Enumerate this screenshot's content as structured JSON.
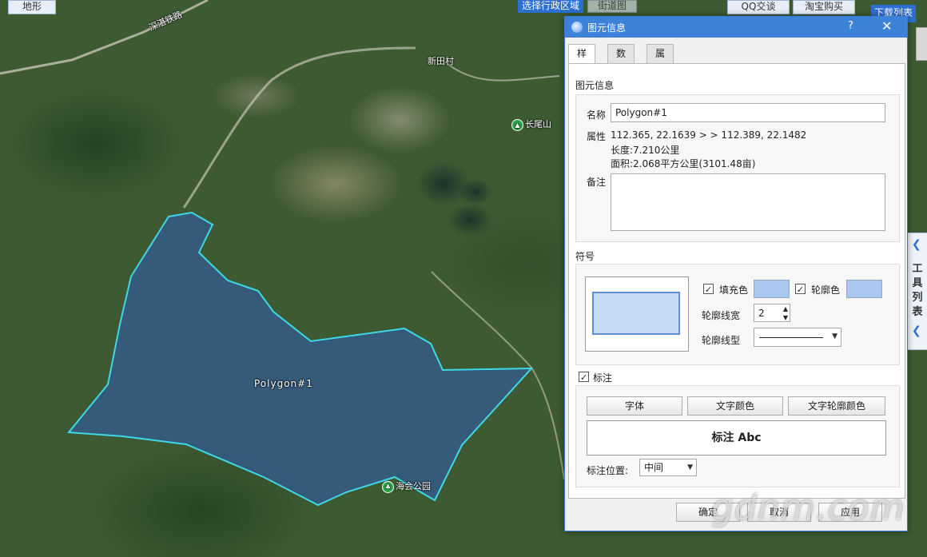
{
  "map": {
    "terrain_button": "地形",
    "region_button": "选择行政区域",
    "top_button_partial": "街道图",
    "qq_button": "QQ交谈",
    "taobao_button": "淘宝购买",
    "download_list": "下载列表",
    "rail_label": "深湛铁路",
    "village_label": "新田村",
    "mountain_label": "长尾山",
    "park_label": "海会公园",
    "polygon_label": "Polygon#1",
    "tool_sidebar": "工具列表"
  },
  "dialog": {
    "title": "图元信息",
    "help": "?",
    "close": "✕",
    "tabs": [
      "样式",
      "数据",
      "属性"
    ],
    "active_tab": 0,
    "info_section": "图元信息",
    "name_label": "名称",
    "name_value": "Polygon#1",
    "attr_label": "属性",
    "attr_coords": "112.365, 22.1639 > > 112.389, 22.1482",
    "length": "长度:7.210公里",
    "area": "面积:2.068平方公里(3101.48亩)",
    "note_label": "备注",
    "note_value": "",
    "symbol_section": "符号",
    "fill_label": "填充色",
    "fill_checked": "✓",
    "outline_label": "轮廓色",
    "outline_checked": "✓",
    "fill_color": "#a9c7ef",
    "outline_color": "#a9c7ef",
    "width_label": "轮廓线宽",
    "width_value": "2",
    "type_label": "轮廓线型",
    "annotate_label": "标注",
    "annotate_checked": "✓",
    "font_button": "字体",
    "text_color_button": "文字颜色",
    "text_outline_button": "文字轮廓颜色",
    "label_preview": "标注 Abc",
    "position_label": "标注位置:",
    "position_value": "中间",
    "ok_button": "确定",
    "cancel_button": "取消",
    "apply_button": "应用"
  },
  "watermark": "gdnm.com"
}
